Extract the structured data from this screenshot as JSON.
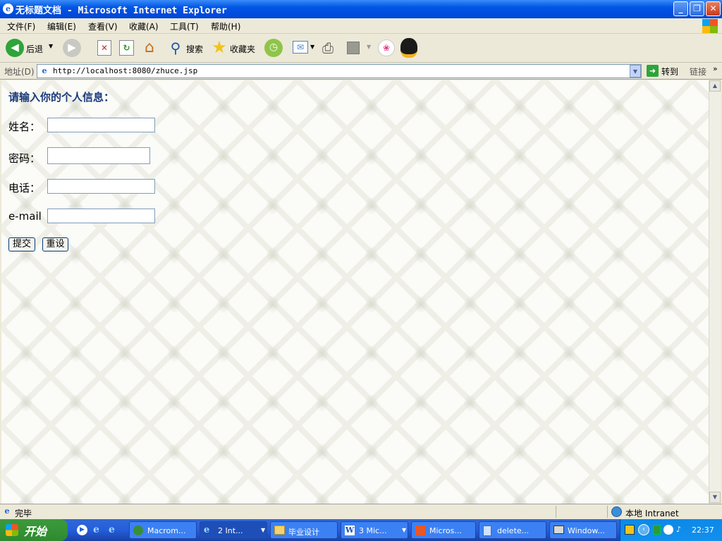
{
  "window": {
    "title": "无标题文档 - Microsoft Internet Explorer"
  },
  "menu": [
    "文件(F)",
    "编辑(E)",
    "查看(V)",
    "收藏(A)",
    "工具(T)",
    "帮助(H)"
  ],
  "toolbar": {
    "back": "后退",
    "search": "搜索",
    "favorites": "收藏夹"
  },
  "address": {
    "label": "地址(D)",
    "url": "http://localhost:8080/zhuce.jsp",
    "go": "转到",
    "links": "链接"
  },
  "form": {
    "heading": "请输入你的个人信息：",
    "fields": [
      {
        "label": "姓名："
      },
      {
        "label": "密码："
      },
      {
        "label": "电话："
      },
      {
        "label": "e-mail"
      }
    ],
    "submit": "提交",
    "reset": "重设"
  },
  "status": {
    "text": "完毕",
    "zone": "本地 Intranet"
  },
  "taskbar": {
    "start": "开始",
    "tasks": [
      "Macrom...",
      "2 Int...",
      "毕业设计",
      "3 Mic...",
      "Micros...",
      "delete...",
      "Window..."
    ],
    "clock": "22:37"
  }
}
